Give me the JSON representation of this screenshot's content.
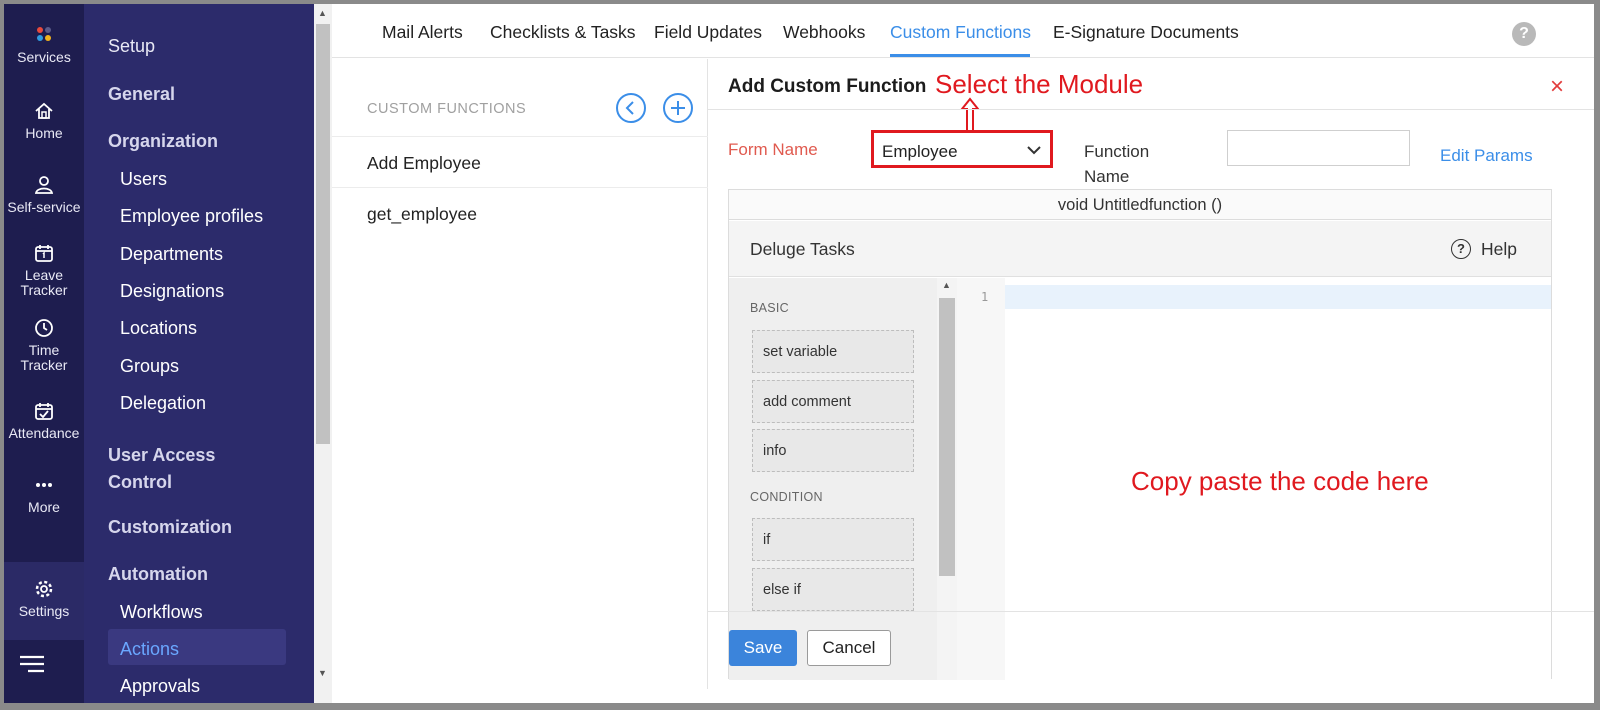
{
  "rail": {
    "items": [
      {
        "label": "Services",
        "icon": "services-dots-icon"
      },
      {
        "label": "Home",
        "icon": "home-icon"
      },
      {
        "label": "Self-service",
        "icon": "user-icon"
      },
      {
        "label": "Leave Tracker",
        "icon": "calendar-icon"
      },
      {
        "label": "Time Tracker",
        "icon": "clock-icon"
      },
      {
        "label": "Attendance",
        "icon": "calendar-check-icon"
      },
      {
        "label": "More",
        "icon": "more-dots-icon"
      },
      {
        "label": "Settings",
        "icon": "gear-icon"
      }
    ]
  },
  "nav": {
    "setup": "Setup",
    "general": "General",
    "organization": "Organization",
    "users": "Users",
    "employee_profiles": "Employee profiles",
    "departments": "Departments",
    "designations": "Designations",
    "locations": "Locations",
    "groups": "Groups",
    "delegation": "Delegation",
    "user_access_control": "User Access Control",
    "customization": "Customization",
    "automation": "Automation",
    "workflows": "Workflows",
    "actions": "Actions",
    "approvals": "Approvals"
  },
  "tabs": {
    "mail_alerts": "Mail Alerts",
    "checklists": "Checklists & Tasks",
    "field_updates": "Field Updates",
    "webhooks": "Webhooks",
    "custom_functions": "Custom Functions",
    "esignature": "E-Signature Documents",
    "help": "?"
  },
  "list": {
    "title": "CUSTOM FUNCTIONS",
    "items": [
      "Add Employee",
      "get_employee"
    ]
  },
  "panel": {
    "title": "Add Custom Function",
    "close": "×",
    "form_name_label": "Form Name",
    "form_name_value": "Employee",
    "function_name_label_1": "Function",
    "function_name_label_2": "Name",
    "function_name_value": "",
    "edit_params": "Edit Params",
    "signature": "void Untitledfunction ()",
    "deluge_title": "Deluge Tasks",
    "help_icon": "?",
    "help_label": "Help",
    "categories": {
      "basic": "BASIC",
      "condition": "CONDITION"
    },
    "tasks": {
      "set_variable": "set variable",
      "add_comment": "add comment",
      "info": "info",
      "if": "if",
      "else_if": "else if"
    },
    "line_number": "1",
    "save": "Save",
    "cancel": "Cancel"
  },
  "annotations": {
    "select_module": "Select the Module",
    "copy_paste": "Copy paste the code here",
    "color": "#e0191f"
  },
  "colors": {
    "rail_bg": "#1e1d4f",
    "nav_bg": "#2c2b6b",
    "accent": "#3b8ee8",
    "save_btn": "#3b84db"
  }
}
